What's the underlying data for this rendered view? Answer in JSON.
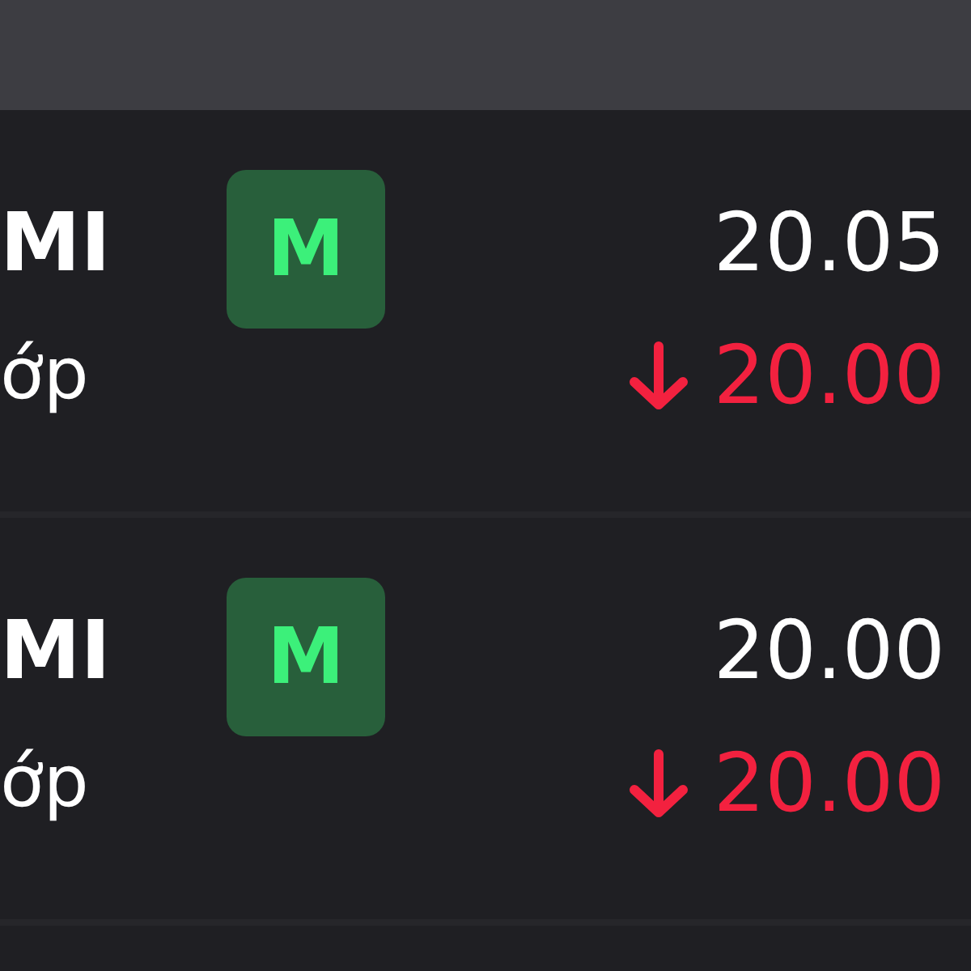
{
  "rows": [
    {
      "symbol": "MI",
      "subtitle": "ớp",
      "badge": "M",
      "price": "20.05",
      "change": {
        "falling": true,
        "value": "20.00"
      }
    },
    {
      "symbol": "MI",
      "subtitle": "ớp",
      "badge": "M",
      "price": "20.00",
      "change": {
        "falling": true,
        "value": "20.00"
      }
    }
  ]
}
